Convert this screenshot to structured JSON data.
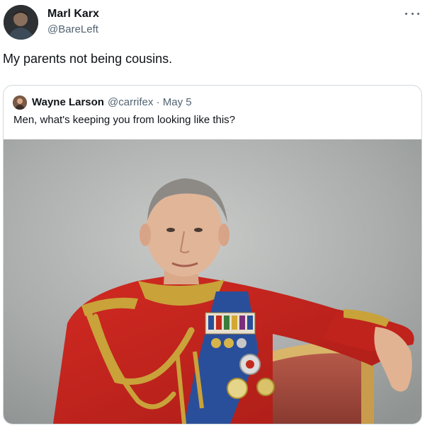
{
  "tweet": {
    "author": {
      "display_name": "Marl Karx",
      "handle": "@BareLeft",
      "avatar_icon": "profile-avatar"
    },
    "more_icon": "more-horizontal-icon",
    "text": "My parents not being cousins."
  },
  "quote": {
    "author": {
      "display_name": "Wayne Larson",
      "handle": "@carrifex",
      "avatar_icon": "profile-avatar"
    },
    "separator": "·",
    "date": "May 5",
    "text": "Men, what's keeping you from looking like this?",
    "media_icon": "portrait-photo"
  },
  "colors": {
    "text_primary": "#0f1419",
    "text_secondary": "#536471",
    "border": "#cfd9de",
    "uniform_red": "#c4241d",
    "sash_blue": "#2a4f9a",
    "gold": "#c9a23a"
  }
}
